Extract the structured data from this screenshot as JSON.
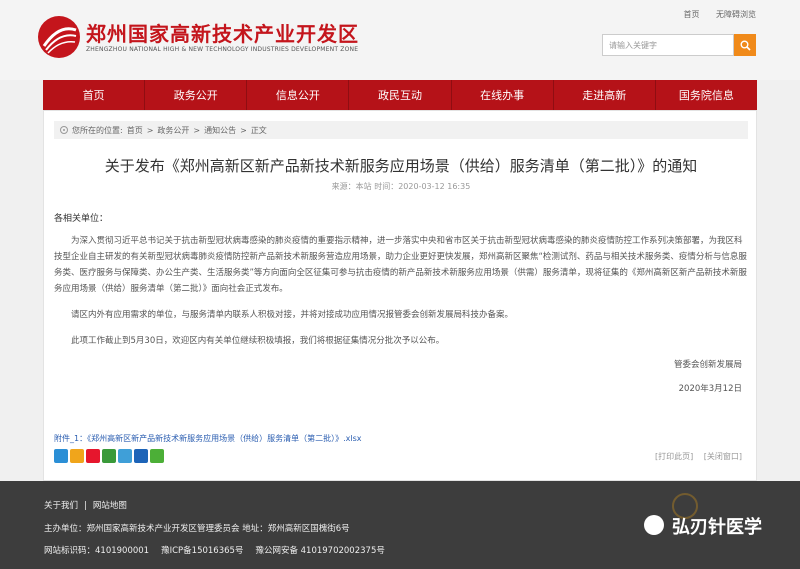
{
  "header": {
    "site_title": "郑州国家高新技术产业开发区",
    "site_subtitle": "ZHENGZHOU NATIONAL HIGH & NEW TECHNOLOGY INDUSTRIES DEVELOPMENT ZONE",
    "top_links": [
      "首页",
      "无障碍浏览"
    ],
    "search_placeholder": "请输入关键字"
  },
  "nav": [
    "首页",
    "政务公开",
    "信息公开",
    "政民互动",
    "在线办事",
    "走进高新",
    "国务院信息"
  ],
  "breadcrumb": {
    "prefix": "您所在的位置:",
    "items": [
      "首页",
      "政务公开",
      "通知公告",
      "正文"
    ],
    "separator": ">"
  },
  "article": {
    "title": "关于发布《郑州高新区新产品新技术新服务应用场景（供给）服务清单（第二批）》的通知",
    "meta": "来源：本站   时间：2020-03-12 16:35",
    "salutation": "各相关单位：",
    "paragraphs": [
      "为深入贯彻习近平总书记关于抗击新型冠状病毒感染的肺炎疫情的重要指示精神，进一步落实中央和省市区关于抗击新型冠状病毒感染的肺炎疫情防控工作系列决策部署，为我区科技型企业自主研发的有关新型冠状病毒肺炎疫情防控新产品新技术新服务营造应用场景，助力企业更好更快发展，郑州高新区聚焦“检测试剂、药品与相关技术服务类、疫情分析与信息服务类、医疗服务与保障类、办公生产类、生活服务类”等方向面向全区征集可参与抗击疫情的新产品新技术新服务应用场景（供需）服务清单，现将征集的《郑州高新区新产品新技术新服务应用场景（供给）服务清单（第二批）》面向社会正式发布。",
      "请区内外有应用需求的单位，与服务清单内联系人积极对接，并将对接成功应用情况报管委会创新发展局科技办备案。",
      "此项工作截止到5月30日，欢迎区内有关单位继续积极填报，我们将根据征集情况分批次予以公布。"
    ],
    "signature": "管委会创新发展局",
    "date": "2020年3月12日",
    "attachment": "附件_1：《郑州高新区新产品新技术新服务应用场景（供给）服务清单（第二批）》.xlsx",
    "actions": [
      "[打印此页]",
      "[关闭窗口]"
    ]
  },
  "share_icons": [
    {
      "name": "share-more-icon",
      "color": "#2b8fd6"
    },
    {
      "name": "share-qzone-icon",
      "color": "#f0a51b"
    },
    {
      "name": "share-weibo-icon",
      "color": "#e6162d"
    },
    {
      "name": "share-douban-icon",
      "color": "#3a9a3a"
    },
    {
      "name": "share-tqq-icon",
      "color": "#3f9fd8"
    },
    {
      "name": "share-renren-icon",
      "color": "#1d64b8"
    },
    {
      "name": "share-wechat-icon",
      "color": "#4caf37"
    }
  ],
  "footer": {
    "links": [
      "关于我们",
      "网站地图"
    ],
    "host": "主办单位：郑州国家高新技术产业开发区管理委员会   地址：郑州高新区国槐街6号",
    "site_code": "网站标识码：4101900001",
    "icp": "豫ICP备15016365号",
    "police": "豫公网安备 41019702002375号",
    "watermark": "弘刃针医学"
  },
  "colors": {
    "brand_red": "#c4151c",
    "nav_red": "#b51218",
    "footer_bg": "#3d3d3d",
    "search_orange": "#f08a1a",
    "link_blue": "#2a5db0"
  }
}
